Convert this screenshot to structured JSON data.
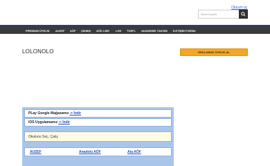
{
  "header": {
    "login_link": "Oturum aç",
    "search_placeholder": "Search posts"
  },
  "nav": {
    "items": [
      "PREMIUM ÜYELİK",
      "AUZEF",
      "AÖF",
      "ÇIKMIŞ",
      "AÖK LİSE",
      "LGS",
      "TOEFL",
      "AKADEMİK TAKVİM",
      "İLETİŞİM FORMU"
    ]
  },
  "main": {
    "title": "LOLONOLO",
    "cta_label": "REKLAMSIZ ÜYELİK AL"
  },
  "panel": {
    "google_text": "PLay Google Mağazamız",
    "google_link": "-> İndir",
    "ios_text": "IOS Uygulamamız",
    "ios_link": "-> İndir",
    "school_select": "Okulunu Seç, Çalış",
    "schools": [
      "AUZEF",
      "Anadolu AÖF",
      "Ata AÖF"
    ]
  },
  "colors": {
    "nav_bg": "#3b3b3b",
    "cta_bg": "#f5a623",
    "panel_bg": "#a9c6ea",
    "link": "#1f4fb5"
  }
}
